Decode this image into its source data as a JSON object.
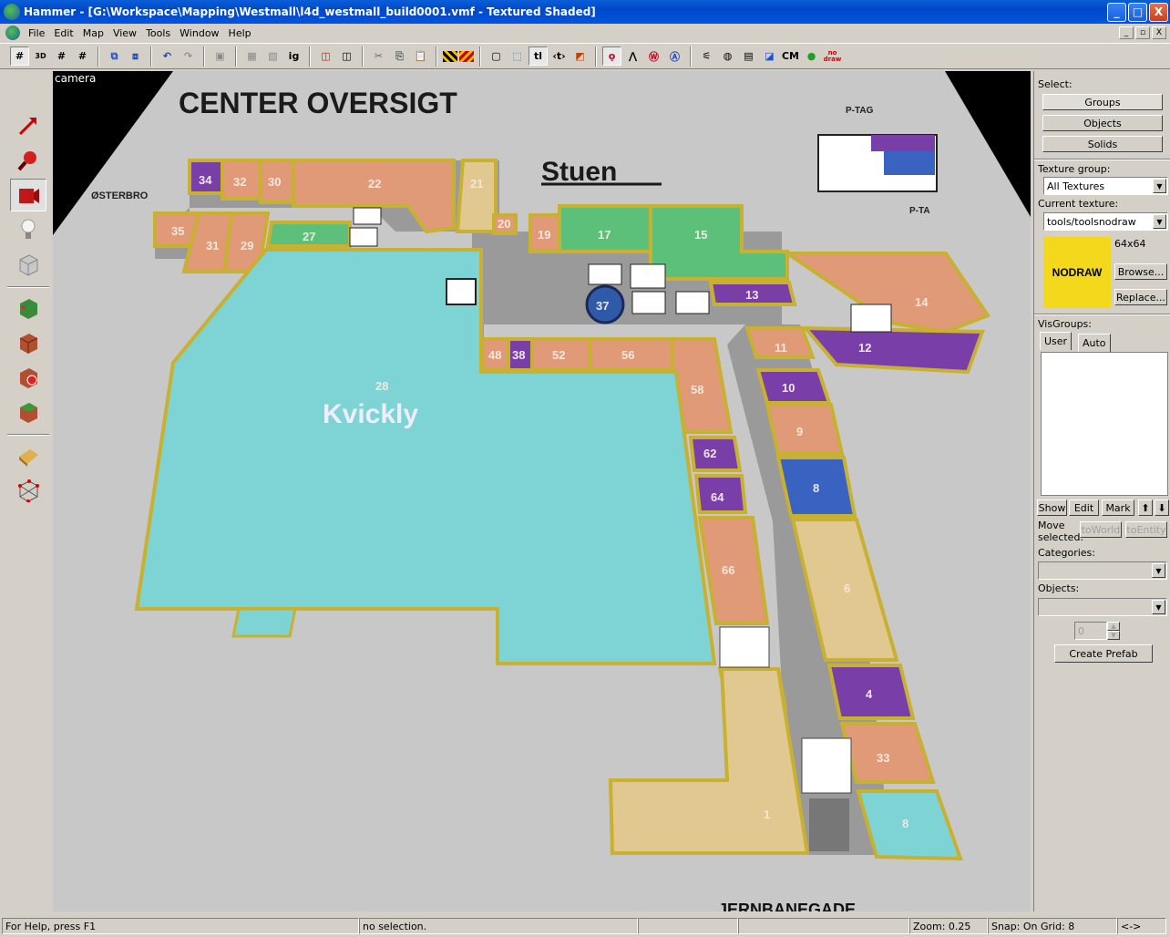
{
  "window": {
    "title": "Hammer - [G:\\Workspace\\Mapping\\Westmall\\l4d_westmall_build0001.vmf - Textured Shaded]",
    "min": "_",
    "max": "□",
    "close": "X"
  },
  "menu": [
    "File",
    "Edit",
    "Map",
    "View",
    "Tools",
    "Window",
    "Help"
  ],
  "toolbar": {
    "text_buttons": {
      "ig": "ig",
      "tl": "tl",
      "tb": "‹t›",
      "cm": "CM",
      "nodraw": "no draw"
    }
  },
  "viewport": {
    "label": "camera",
    "map": {
      "title": "CENTER OVERSIGT",
      "floor": "Stuen",
      "west_label": "ØSTERBRO",
      "ptag1": "P-TAG",
      "ptag2": "P-TA",
      "anchor_name": "Kvickly",
      "bottom_label": "JERNBANEGADE",
      "units": [
        "34",
        "32",
        "30",
        "22",
        "21",
        "20",
        "19",
        "17",
        "15",
        "35",
        "31",
        "29",
        "27",
        "13",
        "14",
        "12",
        "11",
        "10",
        "9",
        "8",
        "6",
        "4",
        "33",
        "8",
        "48",
        "38",
        "52",
        "56",
        "58",
        "62",
        "64",
        "66",
        "1",
        "28",
        "37",
        "10",
        "12"
      ]
    }
  },
  "panel": {
    "select_label": "Select:",
    "select_buttons": [
      "Groups",
      "Objects",
      "Solids"
    ],
    "texture_group_label": "Texture group:",
    "texture_group_value": "All Textures",
    "current_texture_label": "Current texture:",
    "current_texture_value": "tools/toolsnodraw",
    "texture_preview_text": "NODRAW",
    "texture_size": "64x64",
    "browse": "Browse...",
    "replace": "Replace...",
    "visgroups_label": "VisGroups:",
    "tabs": [
      "User",
      "Auto"
    ],
    "vis_buttons": [
      "Show",
      "Edit",
      "Mark"
    ],
    "move_selected": "Move\nselected:",
    "to_world": "toWorld",
    "to_entity": "toEntity",
    "categories_label": "Categories:",
    "objects_label": "Objects:",
    "spinner_value": "0",
    "create_prefab": "Create Prefab"
  },
  "status": {
    "help": "For Help, press F1",
    "selection": "no selection.",
    "zoom": "Zoom: 0.25",
    "snap": "Snap: On Grid: 8",
    "arrows": "<->"
  },
  "colors": {
    "salmon": "#e09a78",
    "green": "#5cc07a",
    "purple": "#7a3ea8",
    "blue": "#3a62c0",
    "cyan": "#7ed4d4",
    "tan": "#e0c890",
    "wall": "#c8b030",
    "floor": "#c8c8c8"
  }
}
